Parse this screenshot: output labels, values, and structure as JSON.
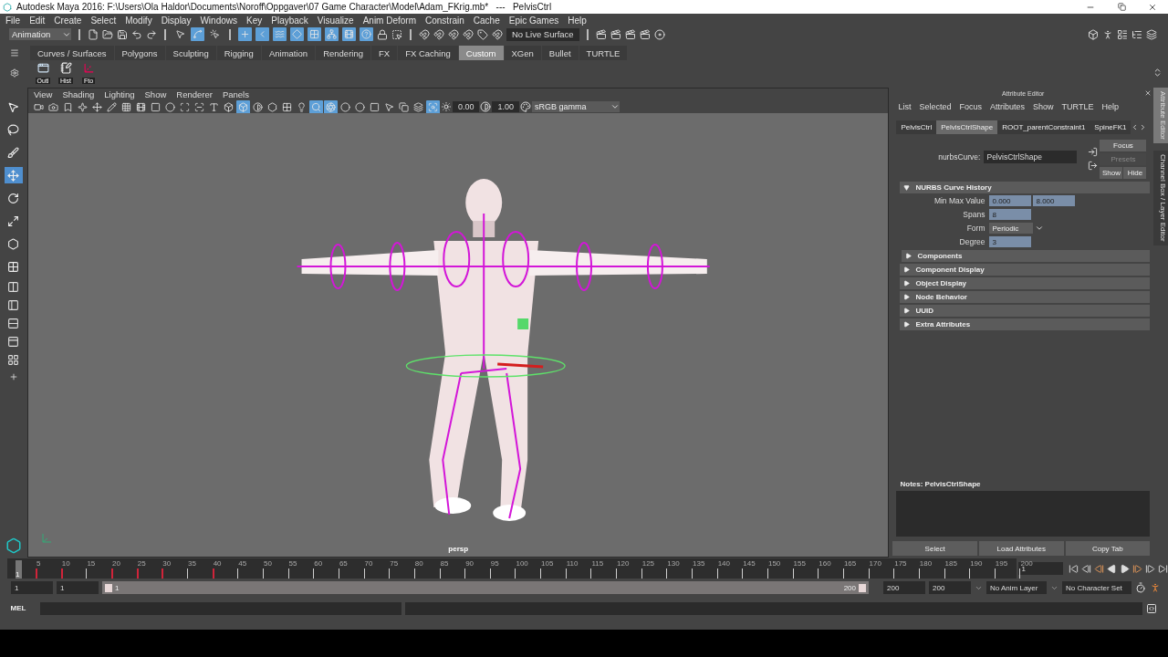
{
  "window": {
    "title": "Autodesk Maya 2016: F:\\Users\\Ola Haldor\\Documents\\Noroff\\Oppgaver\\07 Game Character\\Model\\Adam_FKrig.mb*   ---   PelvisCtrl"
  },
  "menu_bar": [
    "File",
    "Edit",
    "Create",
    "Select",
    "Modify",
    "Display",
    "Windows",
    "Key",
    "Playback",
    "Visualize",
    "Anim Deform",
    "Constrain",
    "Cache",
    "Epic Games",
    "Help"
  ],
  "status_line": {
    "mode": "Animation",
    "select_modes": [
      {
        "selected": false
      },
      {
        "selected": true
      },
      {
        "selected": false
      }
    ],
    "masks": [
      {
        "on": true
      },
      {
        "on": true
      },
      {
        "on": true
      },
      {
        "on": true
      },
      {
        "on": true
      },
      {
        "on": true
      },
      {
        "on": true
      },
      {
        "on": true
      }
    ],
    "live_surface": "No Live Surface"
  },
  "shelf": {
    "tabs": [
      {
        "label": "Curves / Surfaces",
        "selected": false
      },
      {
        "label": "Polygons",
        "selected": false
      },
      {
        "label": "Sculpting",
        "selected": false
      },
      {
        "label": "Rigging",
        "selected": false
      },
      {
        "label": "Animation",
        "selected": false
      },
      {
        "label": "Rendering",
        "selected": false
      },
      {
        "label": "FX",
        "selected": false
      },
      {
        "label": "FX Caching",
        "selected": false
      },
      {
        "label": "Custom",
        "selected": true
      },
      {
        "label": "XGen",
        "selected": false
      },
      {
        "label": "Bullet",
        "selected": false
      },
      {
        "label": "TURTLE",
        "selected": false
      }
    ],
    "buttons": [
      "Outl",
      "Hist",
      "Fto"
    ]
  },
  "toolbox": {
    "tools": [
      {
        "selected": false
      },
      {
        "selected": false
      },
      {
        "selected": false
      },
      {
        "selected": true
      },
      {
        "selected": false
      },
      {
        "selected": false
      },
      {
        "selected": false
      },
      {
        "selected": false
      }
    ]
  },
  "viewport": {
    "menu": [
      "View",
      "Shading",
      "Lighting",
      "Show",
      "Renderer",
      "Panels"
    ],
    "toggles": [
      {
        "on": false
      },
      {
        "on": false
      },
      {
        "on": false
      },
      {
        "on": false
      },
      {
        "on": false
      },
      {
        "on": false
      },
      {
        "on": false
      },
      {
        "on": false
      },
      {
        "on": false
      },
      {
        "on": false
      },
      {
        "on": false
      },
      {
        "on": false
      },
      {
        "on": false
      },
      {
        "on": false
      },
      {
        "on": true
      },
      {
        "on": false
      },
      {
        "on": false
      },
      {
        "on": false
      },
      {
        "on": false
      },
      {
        "on": true
      },
      {
        "on": true
      },
      {
        "on": false
      },
      {
        "on": false
      },
      {
        "on": false
      },
      {
        "on": false
      },
      {
        "on": false
      },
      {
        "on": false
      },
      {
        "on": true
      }
    ],
    "exposure": "0.00",
    "gamma": "1.00",
    "color_space": "sRGB gamma",
    "camera": "persp"
  },
  "attribute_editor": {
    "title": "Attribute Editor",
    "menu": [
      "List",
      "Selected",
      "Focus",
      "Attributes",
      "Show",
      "TURTLE",
      "Help"
    ],
    "tabs": [
      {
        "label": "PelvisCtrl",
        "selected": false
      },
      {
        "label": "PelvisCtrlShape",
        "selected": true
      },
      {
        "label": "ROOT_parentConstraint1",
        "selected": false
      },
      {
        "label": "SpineFK1",
        "selected": false
      }
    ],
    "node_label": "nurbsCurve:",
    "node_name": "PelvisCtrlShape",
    "side_buttons": [
      {
        "label": "Focus",
        "disabled": false
      },
      {
        "label": "Presets",
        "disabled": true
      },
      {
        "label": "Show",
        "disabled": false
      },
      {
        "label": "Hide",
        "disabled": false
      }
    ],
    "sections": [
      {
        "title": "NURBS Curve History",
        "expanded": true,
        "fields": [
          {
            "label": "Min Max Value",
            "kind": "pair",
            "values": [
              "0.000",
              "8.000"
            ]
          },
          {
            "label": "Spans",
            "kind": "number",
            "values": [
              "8"
            ]
          },
          {
            "label": "Form",
            "kind": "dropdown",
            "values": [
              "Periodic"
            ]
          },
          {
            "label": "Degree",
            "kind": "number",
            "values": [
              "3"
            ]
          }
        ]
      },
      {
        "title": "Components",
        "expanded": false
      },
      {
        "title": "Component Display",
        "expanded": false
      },
      {
        "title": "Object Display",
        "expanded": false
      },
      {
        "title": "Node Behavior",
        "expanded": false
      },
      {
        "title": "UUID",
        "expanded": false
      },
      {
        "title": "Extra Attributes",
        "expanded": false
      }
    ],
    "notes_label": "Notes:  PelvisCtrlShape",
    "buttons": [
      "Select",
      "Load Attributes",
      "Copy Tab"
    ]
  },
  "side_tabs": [
    {
      "label": "Attribute Editor",
      "selected": true
    },
    {
      "label": "Channel Box / Layer Editor",
      "selected": false
    }
  ],
  "time_slider": {
    "current": "1",
    "current_frame": "1",
    "ticks": [
      {
        "label": "5",
        "key": true
      },
      {
        "label": "10",
        "key": true
      },
      {
        "label": "15",
        "key": false
      },
      {
        "label": "20",
        "key": true
      },
      {
        "label": "25",
        "key": true
      },
      {
        "label": "30",
        "key": true
      },
      {
        "label": "35",
        "key": false
      },
      {
        "label": "40",
        "key": true
      },
      {
        "label": "45",
        "key": false
      },
      {
        "label": "50",
        "key": false
      },
      {
        "label": "55",
        "key": false
      },
      {
        "label": "60",
        "key": false
      },
      {
        "label": "65",
        "key": false
      },
      {
        "label": "70",
        "key": false
      },
      {
        "label": "75",
        "key": false
      },
      {
        "label": "80",
        "key": false
      },
      {
        "label": "85",
        "key": false
      },
      {
        "label": "90",
        "key": false
      },
      {
        "label": "95",
        "key": false
      },
      {
        "label": "100",
        "key": false
      },
      {
        "label": "105",
        "key": false
      },
      {
        "label": "110",
        "key": false
      },
      {
        "label": "115",
        "key": false
      },
      {
        "label": "120",
        "key": false
      },
      {
        "label": "125",
        "key": false
      },
      {
        "label": "130",
        "key": false
      },
      {
        "label": "135",
        "key": false
      },
      {
        "label": "140",
        "key": false
      },
      {
        "label": "145",
        "key": false
      },
      {
        "label": "150",
        "key": false
      },
      {
        "label": "155",
        "key": false
      },
      {
        "label": "160",
        "key": false
      },
      {
        "label": "165",
        "key": false
      },
      {
        "label": "170",
        "key": false
      },
      {
        "label": "175",
        "key": false
      },
      {
        "label": "180",
        "key": false
      },
      {
        "label": "185",
        "key": false
      },
      {
        "label": "190",
        "key": false
      },
      {
        "label": "195",
        "key": false
      },
      {
        "label": "200",
        "key": false
      }
    ]
  },
  "range_slider": {
    "level": 1,
    "start": "1",
    "playback_start": "1",
    "range_start": "1",
    "range_end": "200",
    "playback_end": "200",
    "end": "200",
    "anim_layer": "No Anim Layer",
    "character_set": "No Character Set"
  },
  "command_line": {
    "language": "MEL"
  }
}
